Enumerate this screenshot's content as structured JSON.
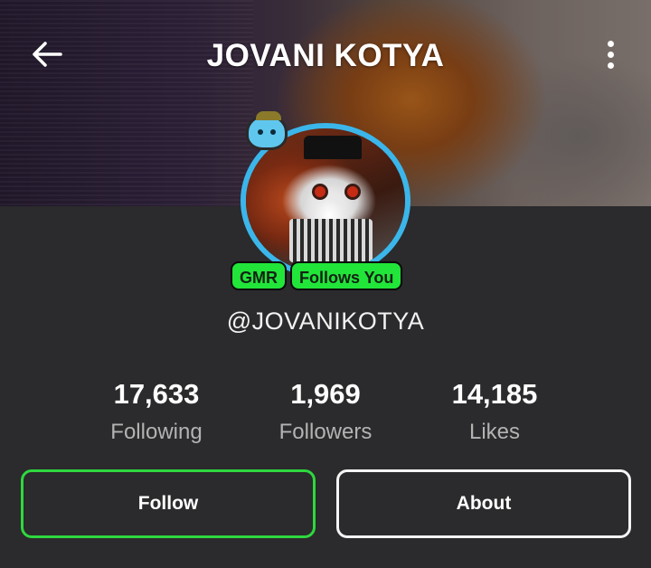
{
  "header": {
    "title": "JOVANI KOTYA",
    "back_icon": "arrow-left-icon",
    "more_icon": "more-vertical-icon"
  },
  "profile": {
    "handle": "@JOVANIKOTYA",
    "badges": [
      "GMR",
      "Follows You"
    ],
    "badge_color": "#22e53a",
    "avatar_ring_color": "#3bb6ea"
  },
  "stats": [
    {
      "value": "17,633",
      "label": "Following"
    },
    {
      "value": "1,969",
      "label": "Followers"
    },
    {
      "value": "14,185",
      "label": "Likes"
    }
  ],
  "actions": {
    "follow_label": "Follow",
    "about_label": "About",
    "follow_border_color": "#2ed83e"
  },
  "colors": {
    "background": "#2b2a2c"
  }
}
